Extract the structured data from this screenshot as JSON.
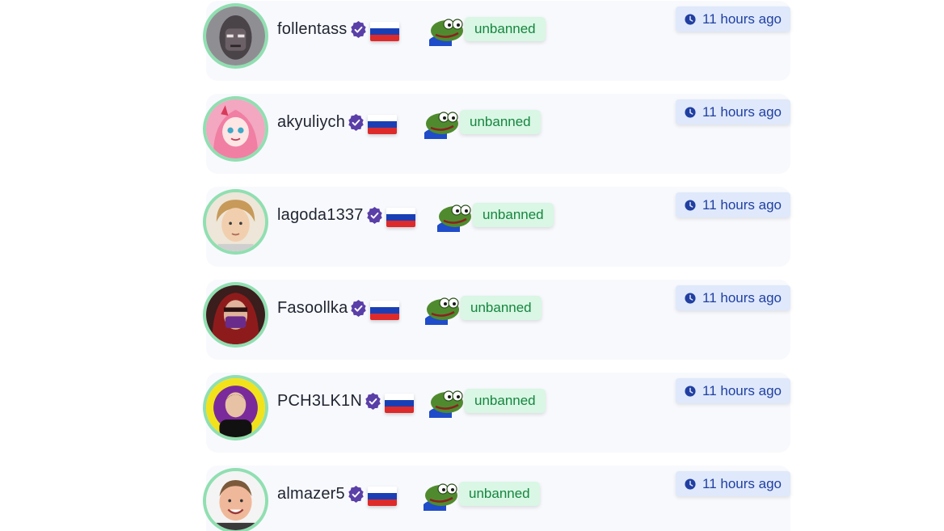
{
  "feed": {
    "items": [
      {
        "username": "follentass",
        "status": "unbanned",
        "time": "11 hours ago",
        "avatar": "masked-face",
        "flag": "russia"
      },
      {
        "username": "akyuliych",
        "status": "unbanned",
        "time": "11 hours ago",
        "avatar": "anime-girl",
        "flag": "russia"
      },
      {
        "username": "lagoda1337",
        "status": "unbanned",
        "time": "11 hours ago",
        "avatar": "blond-boy",
        "flag": "russia"
      },
      {
        "username": "Fasoollka",
        "status": "unbanned",
        "time": "11 hours ago",
        "avatar": "hooded-figure",
        "flag": "russia"
      },
      {
        "username": "PCH3LK1N",
        "status": "unbanned",
        "time": "11 hours ago",
        "avatar": "yellow-bg-person",
        "flag": "russia"
      },
      {
        "username": "almazer5",
        "status": "unbanned",
        "time": "11 hours ago",
        "avatar": "smiling-man",
        "flag": "russia"
      }
    ]
  },
  "colors": {
    "avatar_ring": "#90dfb1",
    "status_bg": "#d9f7e4",
    "status_text": "#16853f",
    "time_bg": "#dfe9fb",
    "time_text": "#213fa1",
    "verified": "#5a3fa8",
    "card_bg": "#f8f9fd"
  },
  "icons": {
    "verified": "verified-badge-icon",
    "clock": "clock-icon",
    "emote": "pepe-emote-icon"
  }
}
